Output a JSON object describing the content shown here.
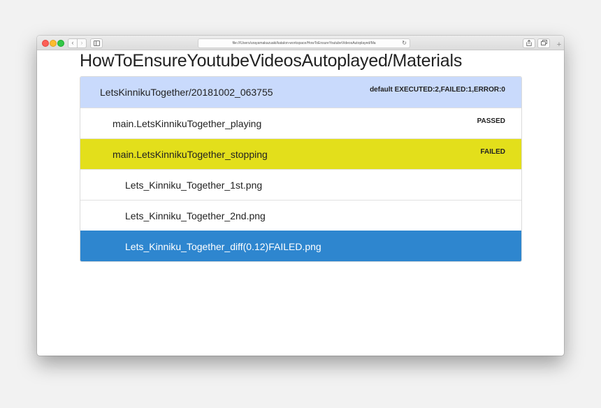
{
  "browser": {
    "url": "file:///Users/urayamakazuaki/katalon-workspace/HowToEnsureYoutubeVideosAutoplayed/Ma",
    "reload_glyph": "↻",
    "back_glyph": "‹",
    "forward_glyph": "›",
    "new_tab_glyph": "+"
  },
  "page": {
    "title": "HowToEnsureYoutubeVideosAutoplayed/Materials"
  },
  "tree": {
    "suite": {
      "label": "LetsKinnikuTogether/20181002_063755",
      "status": "default   EXECUTED:2,FAILED:1,ERROR:0"
    },
    "cases": [
      {
        "label": "main.LetsKinnikuTogether_playing",
        "status": "PASSED"
      },
      {
        "label": "main.LetsKinnikuTogether_stopping",
        "status": "FAILED"
      }
    ],
    "files": [
      {
        "label": "Lets_Kinniku_Together_1st.png"
      },
      {
        "label": "Lets_Kinniku_Together_2nd.png"
      },
      {
        "label": "Lets_Kinniku_Together_diff(0.12)FAILED.png"
      }
    ]
  },
  "colors": {
    "suite_bg": "#c9dafc",
    "failed_bg": "#e3df1b",
    "selected_bg": "#2e86cf"
  }
}
